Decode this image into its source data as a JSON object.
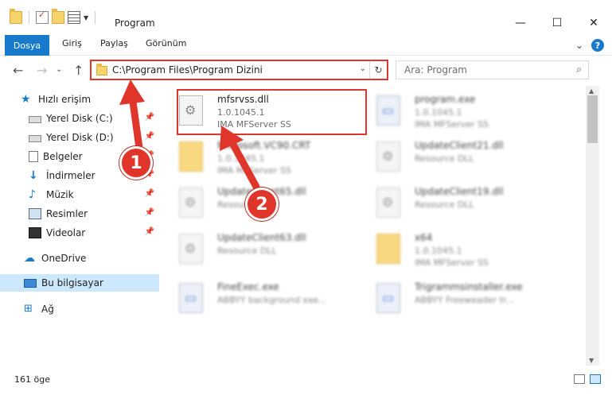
{
  "window": {
    "title": "Program",
    "minimize_glyph": "—",
    "maximize_glyph": "☐",
    "close_glyph": "✕"
  },
  "ribbon": {
    "tabs": [
      "Dosya",
      "Giriş",
      "Paylaş",
      "Görünüm"
    ],
    "expand_glyph": "⌄",
    "help_glyph": "?"
  },
  "address": {
    "path": "C:\\Program Files\\Program Dizini",
    "dropdown_glyph": "⌄",
    "refresh_glyph": "↻",
    "back_glyph": "←",
    "forward_glyph": "→",
    "recent_glyph": "⌄",
    "up_glyph": "↑"
  },
  "search": {
    "placeholder": "Ara: Program",
    "icon": "search-icon"
  },
  "sidebar": {
    "items": [
      {
        "label": "Hızlı erişim",
        "icon": "star-icon"
      },
      {
        "label": "Yerel Disk (C:)",
        "icon": "disk-icon",
        "pinned": true
      },
      {
        "label": "Yerel Disk (D:)",
        "icon": "disk-icon",
        "pinned": true
      },
      {
        "label": "Belgeler",
        "icon": "documents-icon",
        "pinned": true
      },
      {
        "label": "İndirmeler",
        "icon": "downloads-icon",
        "pinned": true
      },
      {
        "label": "Müzik",
        "icon": "music-icon",
        "pinned": true
      },
      {
        "label": "Resimler",
        "icon": "pictures-icon",
        "pinned": true
      },
      {
        "label": "Videolar",
        "icon": "videos-icon",
        "pinned": true
      },
      {
        "label": "OneDrive",
        "icon": "cloud-icon"
      },
      {
        "label": "Bu bilgisayar",
        "icon": "computer-icon",
        "selected": true
      },
      {
        "label": "Ağ",
        "icon": "network-icon"
      }
    ],
    "pin_glyph": "📌"
  },
  "files": [
    {
      "name": "mfsrvss.dll",
      "line2": "1.0.1045.1",
      "line3": "IMA MFServer SS",
      "icon": "dll-icon"
    },
    {
      "name": "program.exe",
      "line2": "1.0.1045.1",
      "line3": "IMA MFServer SS",
      "icon": "exe-icon"
    },
    {
      "name": "Microsoft.VC90.CRT",
      "line2": "1.0.1045.1",
      "line3": "IMA MFServer SS",
      "icon": "folder-icon"
    },
    {
      "name": "UpdateClient21.dll",
      "line2": "Resource DLL",
      "line3": "",
      "icon": "dll-icon"
    },
    {
      "name": "UpdateClient65.dll",
      "line2": "Resource DLL",
      "line3": "",
      "icon": "dll-icon"
    },
    {
      "name": "UpdateClient19.dll",
      "line2": "Resource DLL",
      "line3": "",
      "icon": "dll-icon"
    },
    {
      "name": "UpdateClient63.dll",
      "line2": "Resource DLL",
      "line3": "",
      "icon": "dll-icon"
    },
    {
      "name": "x64",
      "line2": "1.0.1045.1",
      "line3": "IMA MFServer SS",
      "icon": "folder-icon"
    },
    {
      "name": "FineExec.exe",
      "line2": "ABBYY background exe...",
      "line3": "",
      "icon": "exe-icon"
    },
    {
      "name": "Trigrammsinstaller.exe",
      "line2": "ABBYY Freeweader tr...",
      "line3": "",
      "icon": "exe-icon"
    }
  ],
  "status": {
    "item_count": "161 öge"
  },
  "annotations": {
    "step1": "1",
    "step2": "2"
  },
  "colors": {
    "accent": "#1979ca",
    "highlight_red": "#e0352b",
    "selected_bg": "#cce8ff"
  }
}
